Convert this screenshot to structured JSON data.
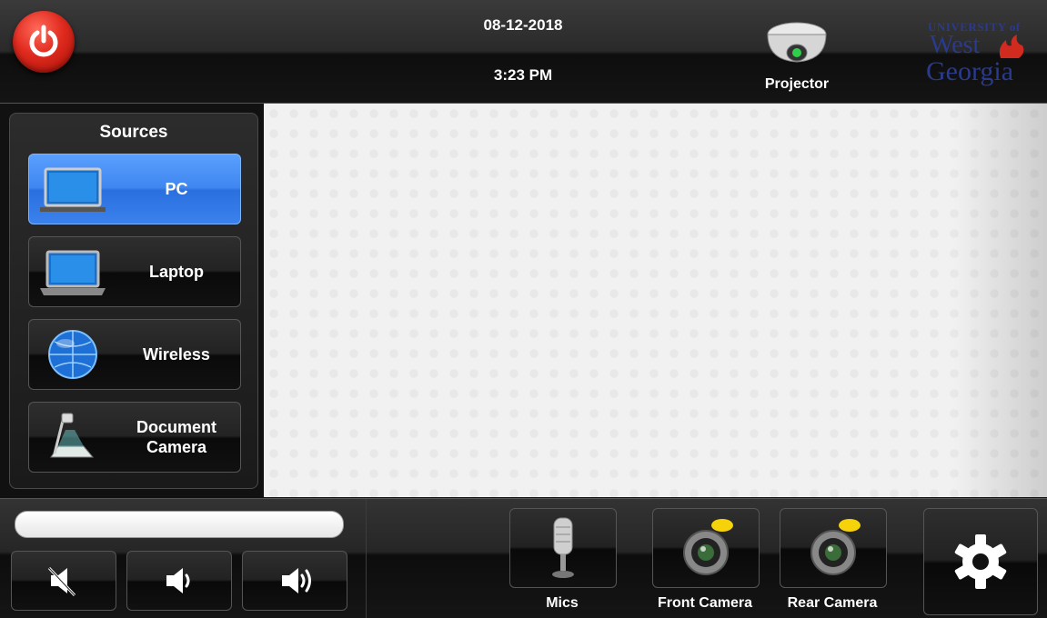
{
  "header": {
    "date": "08-12-2018",
    "time": "3:23 PM",
    "projector_label": "Projector",
    "logo": {
      "line1": "UNIVERSITY of",
      "line2": "West",
      "line3": "Georgia"
    }
  },
  "sources": {
    "title": "Sources",
    "items": [
      {
        "label": "PC",
        "icon": "pc-monitor-icon",
        "active": true
      },
      {
        "label": "Laptop",
        "icon": "laptop-icon",
        "active": false
      },
      {
        "label": "Wireless",
        "icon": "wireless-globe-icon",
        "active": false
      },
      {
        "label_line1": "Document",
        "label_line2": "Camera",
        "icon": "document-camera-icon",
        "active": false
      }
    ]
  },
  "bottom": {
    "volume_level": 1.0,
    "buttons": [
      {
        "name": "mute",
        "icon": "mute-icon"
      },
      {
        "name": "volume-down",
        "icon": "volume-down-icon"
      },
      {
        "name": "volume-up",
        "icon": "volume-up-icon"
      }
    ],
    "tiles": [
      {
        "label": "Mics",
        "icon": "microphone-icon"
      },
      {
        "label": "Front Camera",
        "icon": "camera-icon"
      },
      {
        "label": "Rear Camera",
        "icon": "camera-icon"
      }
    ],
    "settings_icon": "gear-icon"
  },
  "colors": {
    "active_source": "#3f86f0",
    "power": "#e02a1e",
    "logo_blue": "#2a3a8c",
    "logo_red": "#d12a1f"
  }
}
